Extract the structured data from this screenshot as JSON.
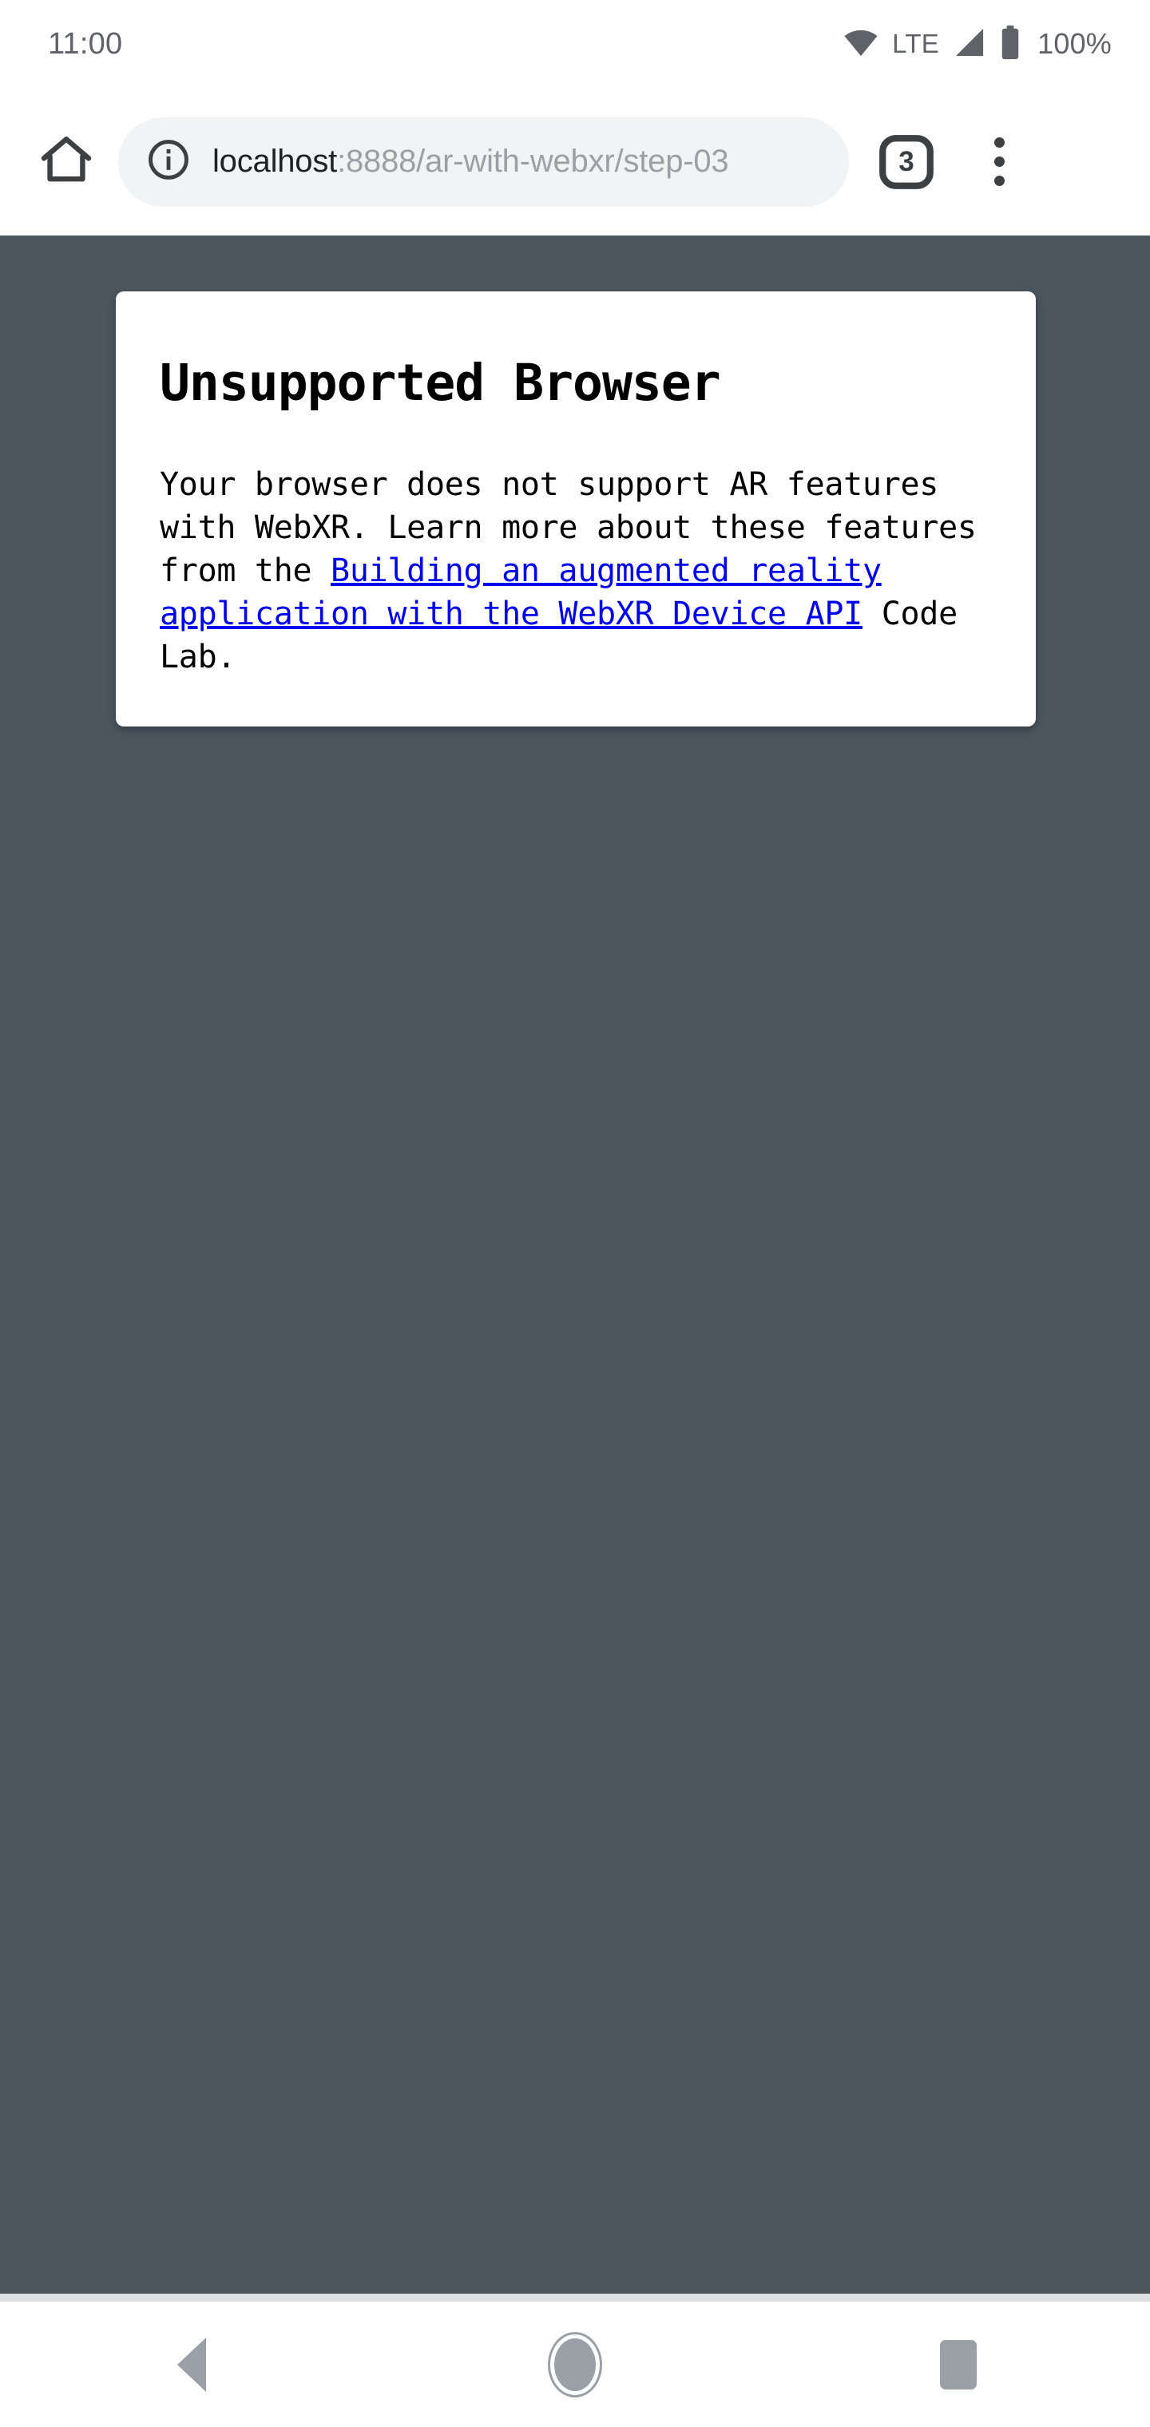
{
  "status_bar": {
    "time": "11:00",
    "wifi_icon": "wifi-icon",
    "network_type": "LTE",
    "signal_icon": "signal-bars-icon",
    "battery_icon": "battery-full-icon",
    "battery_level": "100%"
  },
  "browser": {
    "home_icon": "home-icon",
    "site_info_icon": "info-circle-icon",
    "url_host": "localhost",
    "url_path": ":8888/ar-with-webxr/step-03",
    "url_full": "localhost:8888/ar-with-webxr/step-03",
    "tab_count": "3",
    "overflow_icon": "three-dot-menu-icon"
  },
  "page": {
    "background_color": "#4b565f",
    "card": {
      "title": "Unsupported Browser",
      "body_before_link": "Your browser does not support AR features with WebXR. Learn more about these features from the ",
      "link_text": "Building an augmented reality application with the WebXR Device API",
      "link_color": "#0000ee",
      "body_after_link": " Code Lab."
    }
  },
  "nav_bar": {
    "back_label": "back-icon",
    "home_label": "home-circle-icon",
    "recents_label": "recents-square-icon"
  }
}
